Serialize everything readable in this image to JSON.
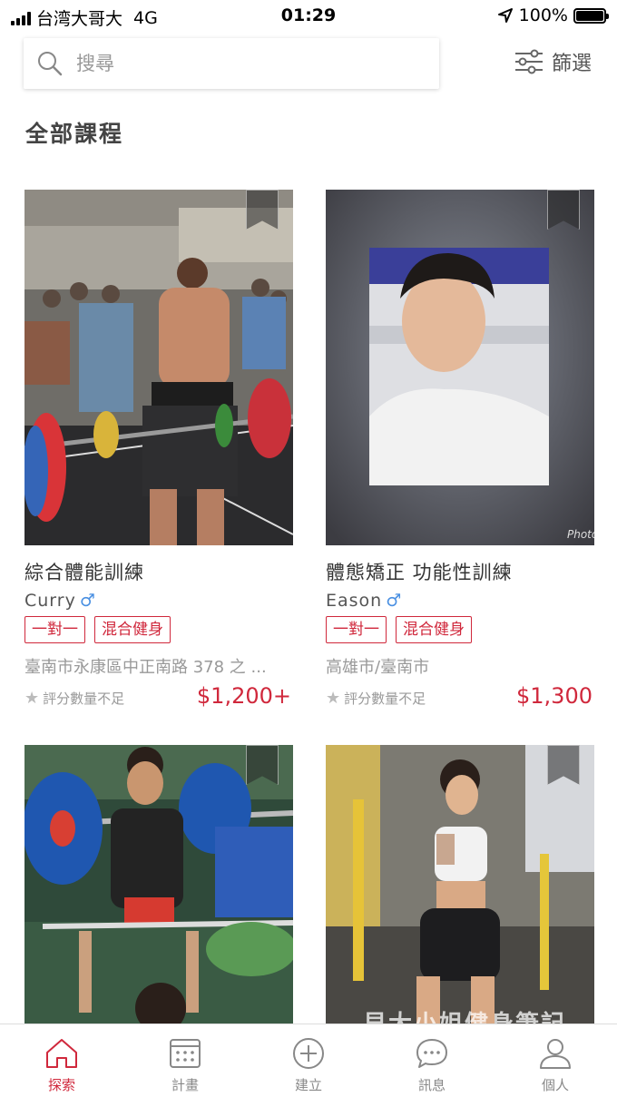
{
  "status_bar": {
    "carrier": "台湾大哥大",
    "network": "4G",
    "time": "01:29",
    "battery": "100%"
  },
  "search": {
    "placeholder": "搜尋",
    "icon": "search-icon"
  },
  "filter": {
    "label": "篩選",
    "icon": "sliders-icon"
  },
  "section_title": "全部課程",
  "courses": [
    {
      "title": "綜合體能訓練",
      "coach": "Curry",
      "gender": "♂",
      "tags": [
        "一對一",
        "混合健身"
      ],
      "location": "臺南市永康區中正南路 378 之 ...",
      "rating": "評分數量不足",
      "price": "$1,200+"
    },
    {
      "title": "體態矯正 功能性訓練",
      "coach": "Eason",
      "gender": "♂",
      "tags": [
        "一對一",
        "混合健身"
      ],
      "location": "高雄市/臺南市",
      "rating": "評分數量不足",
      "price": "$1,300"
    }
  ],
  "photo_overlay": {
    "photo_label": "Photo"
  },
  "tabbar": [
    {
      "label": "探索",
      "icon": "home-icon",
      "active": true
    },
    {
      "label": "計畫",
      "icon": "calendar-icon",
      "active": false
    },
    {
      "label": "建立",
      "icon": "plus-circle-icon",
      "active": false
    },
    {
      "label": "訊息",
      "icon": "chat-icon",
      "active": false
    },
    {
      "label": "個人",
      "icon": "person-icon",
      "active": false
    }
  ],
  "watermark": "貝大小姐健身筆記",
  "colors": {
    "accent": "#d0283c",
    "male": "#4a90e2"
  }
}
